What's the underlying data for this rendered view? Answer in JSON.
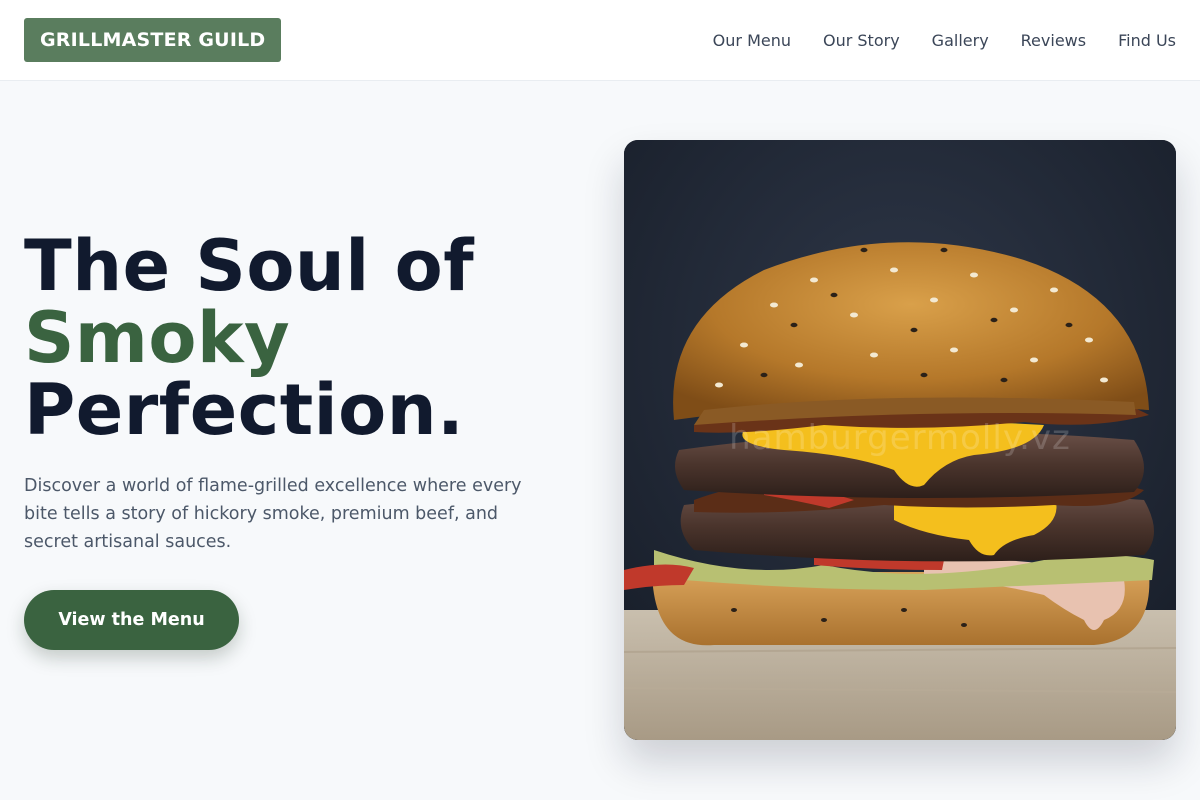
{
  "brand": {
    "name": "GRILLMASTER GUILD",
    "color": "#5a7d5e"
  },
  "nav": {
    "links": [
      "Our Menu",
      "Our Story",
      "Gallery",
      "Reviews",
      "Find Us"
    ]
  },
  "hero": {
    "headline_line1": "The Soul of",
    "headline_accent": "Smoky",
    "headline_line3": "Perfection.",
    "accent_color": "#3a6340",
    "lead": "Discover a world of flame-grilled excellence where every bite tells a story of hickory smoke, premium beef, and secret artisanal sauces.",
    "cta_label": "View the Menu",
    "image": {
      "subject": "double cheeseburger on wooden board",
      "watermark": "hamburgermolly.vz"
    }
  }
}
